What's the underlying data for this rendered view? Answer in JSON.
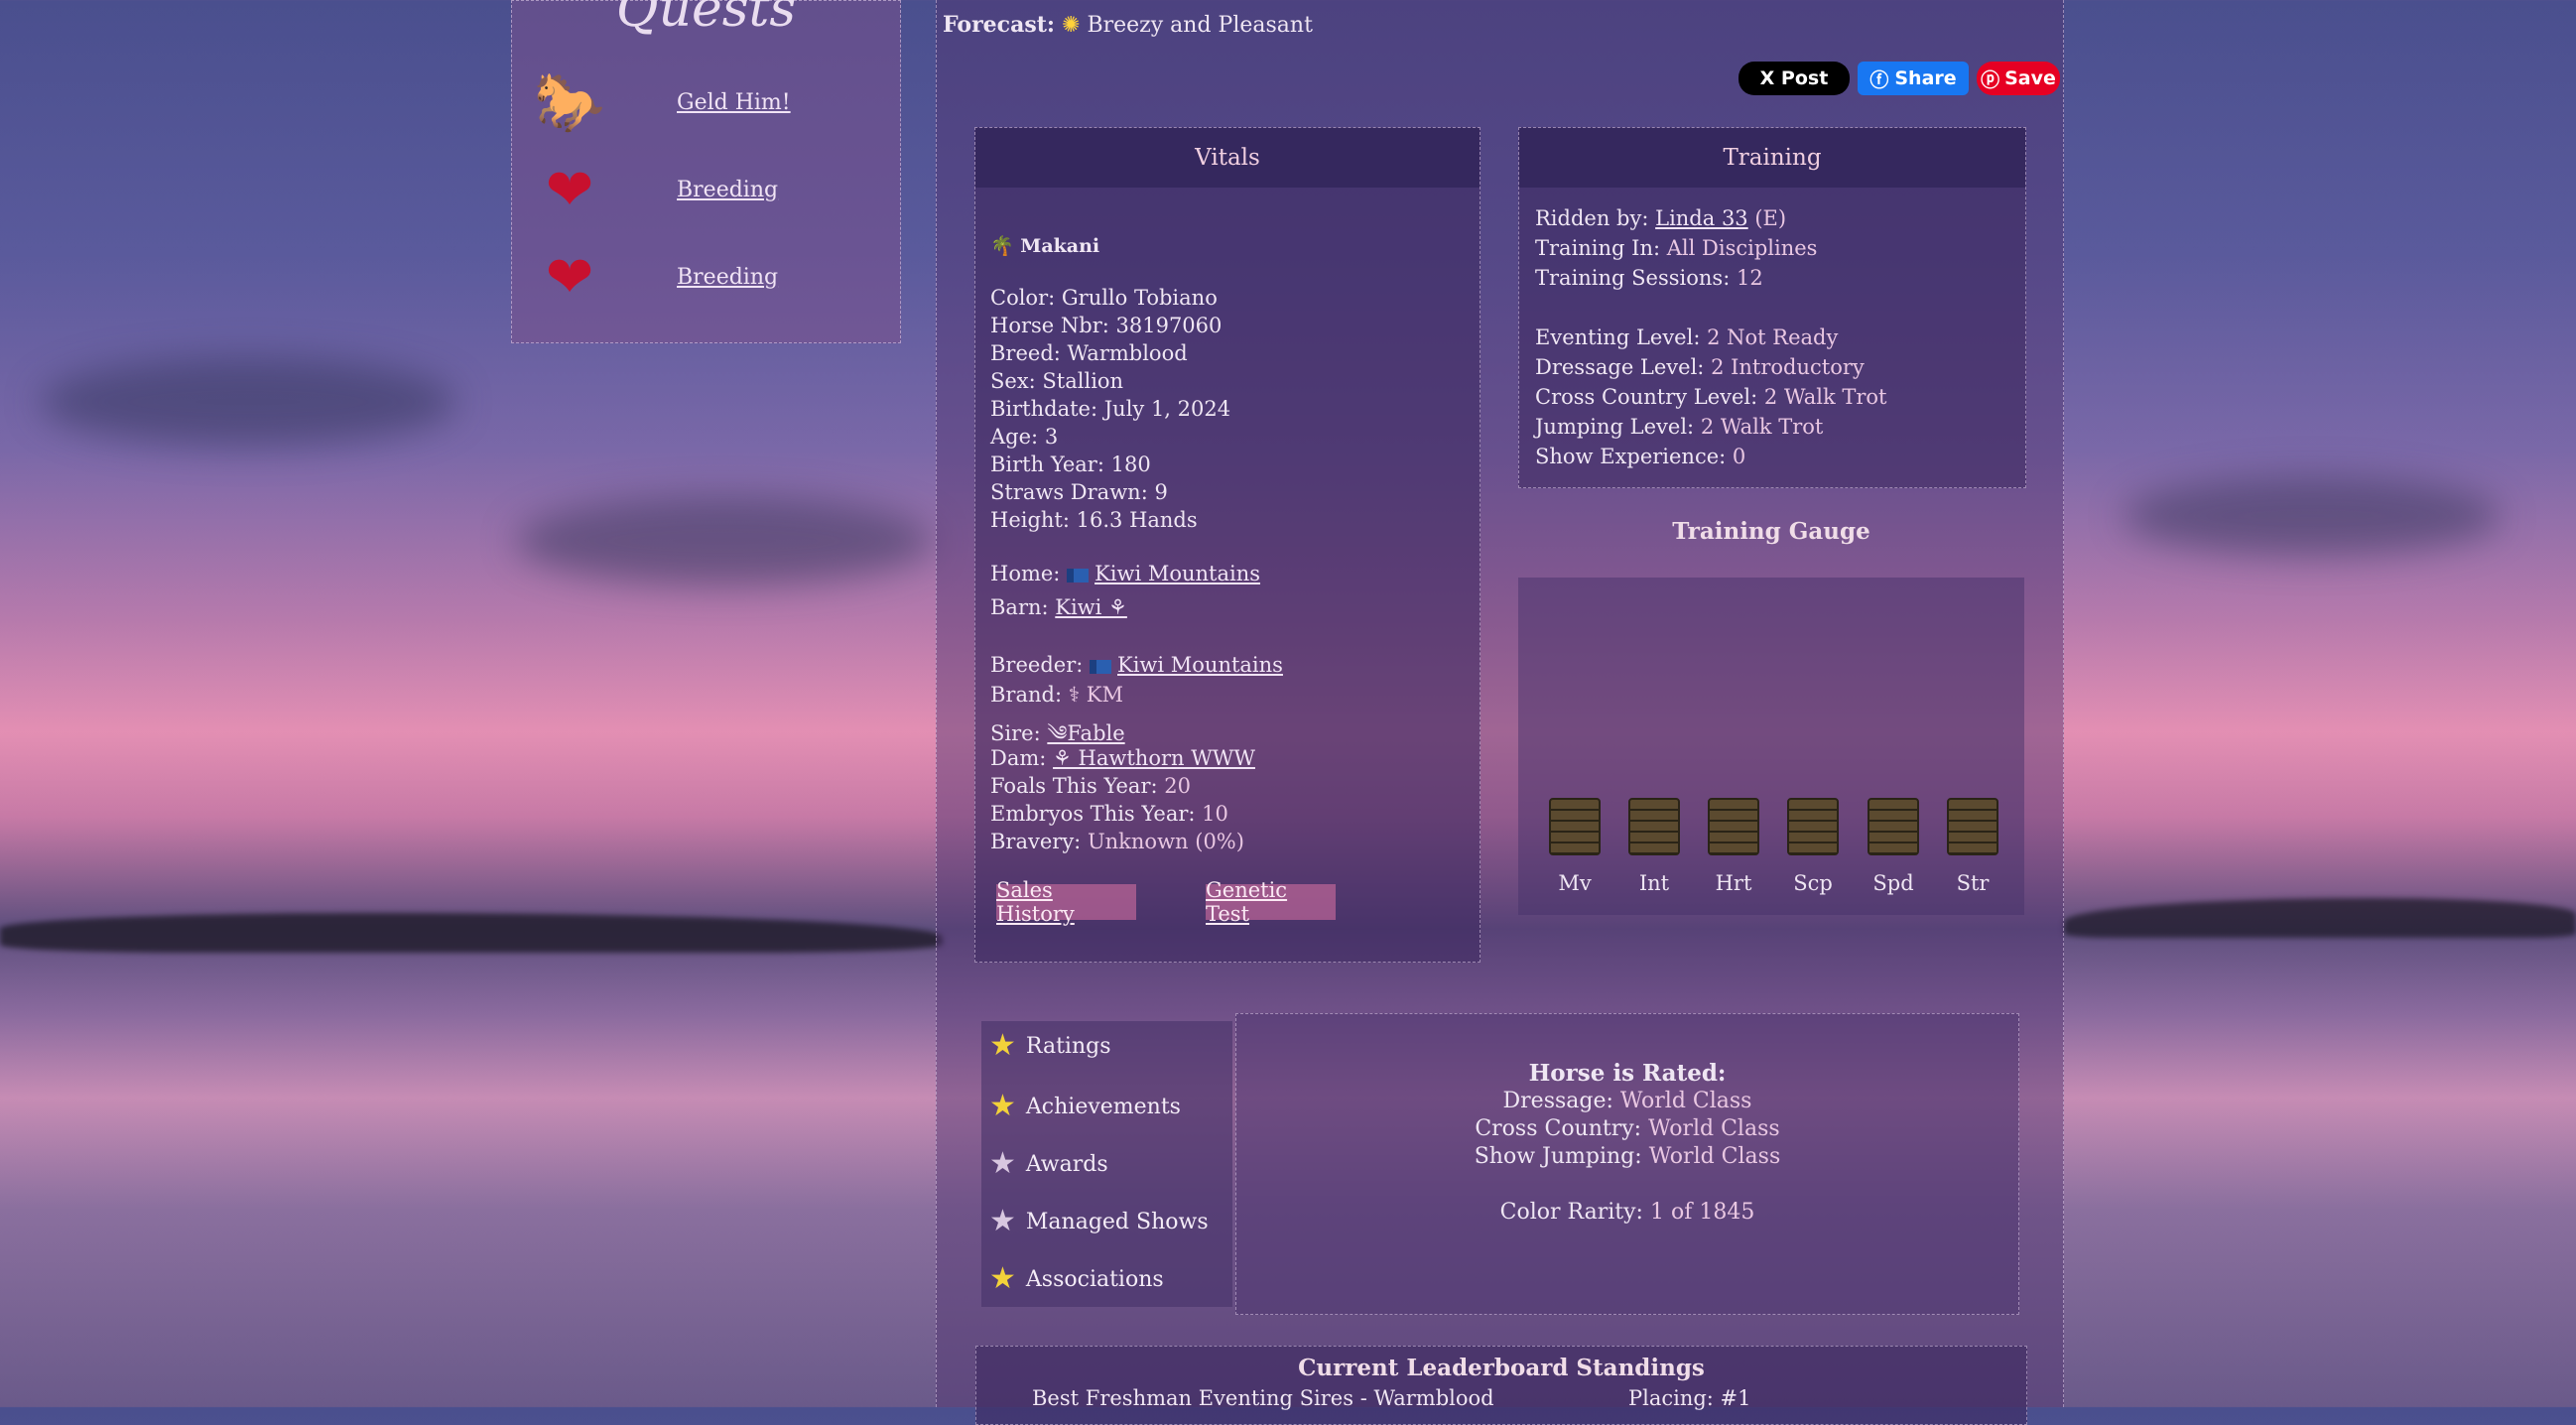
{
  "forecast": {
    "label": "Forecast:",
    "value": "Breezy and Pleasant"
  },
  "social": {
    "x_post": "X Post",
    "fb_share": "Share",
    "pin_save": "Save"
  },
  "quests": {
    "title": "Quests",
    "items": [
      {
        "icon": "horse-icon",
        "label": "Geld Him!"
      },
      {
        "icon": "heart-icon",
        "label": "Breeding"
      },
      {
        "icon": "heart-icon",
        "label": "Breeding"
      }
    ]
  },
  "vitals": {
    "title": "Vitals",
    "name": "Makani",
    "color_label": "Color:",
    "color": "Grullo Tobiano",
    "nbr_label": "Horse Nbr:",
    "nbr": "38197060",
    "breed_label": "Breed:",
    "breed": "Warmblood",
    "sex_label": "Sex:",
    "sex": "Stallion",
    "birthdate_label": "Birthdate:",
    "birthdate": "July 1, 2024",
    "age_label": "Age:",
    "age": "3",
    "birth_year_label": "Birth Year:",
    "birth_year": "180",
    "straws_label": "Straws Drawn:",
    "straws": "9",
    "height_label": "Height:",
    "height": "16.3 Hands",
    "home_label": "Home:",
    "home": "Kiwi Mountains",
    "barn_label": "Barn:",
    "barn": "Kiwi ⚘",
    "breeder_label": "Breeder:",
    "breeder": "Kiwi Mountains",
    "brand_label": "Brand:",
    "brand": "⚕ KM",
    "sire_label": "Sire:",
    "sire": "༄Fable",
    "dam_label": "Dam:",
    "dam": "⚘ Hawthorn WWW",
    "foals_label": "Foals This Year:",
    "foals": "20",
    "embryos_label": "Embryos This Year:",
    "embryos": "10",
    "bravery_label": "Bravery:",
    "bravery": "Unknown (0%)",
    "sales_history": "Sales History",
    "genetic_test": "Genetic Test"
  },
  "training": {
    "title": "Training",
    "ridden_label": "Ridden by:",
    "ridden_by": "Linda 33",
    "ridden_suffix": "(E)",
    "training_in_label": "Training In:",
    "training_in": "All Disciplines",
    "sessions_label": "Training Sessions:",
    "sessions": "12",
    "eventing_label": "Eventing Level:",
    "eventing": "2 Not Ready",
    "dressage_label": "Dressage Level:",
    "dressage": "2 Introductory",
    "cross_label": "Cross Country Level:",
    "cross": "2 Walk Trot",
    "jumping_label": "Jumping Level:",
    "jumping": "2 Walk Trot",
    "show_exp_label": "Show Experience:",
    "show_exp": "0"
  },
  "gauge": {
    "title": "Training Gauge",
    "labels": [
      "Mv",
      "Int",
      "Hrt",
      "Scp",
      "Spd",
      "Str"
    ]
  },
  "menu": {
    "items": [
      {
        "label": "Ratings",
        "star": "gold"
      },
      {
        "label": "Achievements",
        "star": "gold"
      },
      {
        "label": "Awards",
        "star": "silver"
      },
      {
        "label": "Managed Shows",
        "star": "silver"
      },
      {
        "label": "Associations",
        "star": "gold"
      }
    ]
  },
  "rated": {
    "title": "Horse is Rated:",
    "dressage_label": "Dressage:",
    "dressage": "World Class",
    "cross_label": "Cross Country:",
    "cross": "World Class",
    "jumping_label": "Show Jumping:",
    "jumping": "World Class",
    "rarity_label": "Color Rarity:",
    "rarity": "1 of 1845"
  },
  "leaderboard": {
    "title": "Current Leaderboard Standings",
    "row_name": "Best Freshman Eventing Sires - Warmblood",
    "row_placing": "Placing: #1"
  }
}
